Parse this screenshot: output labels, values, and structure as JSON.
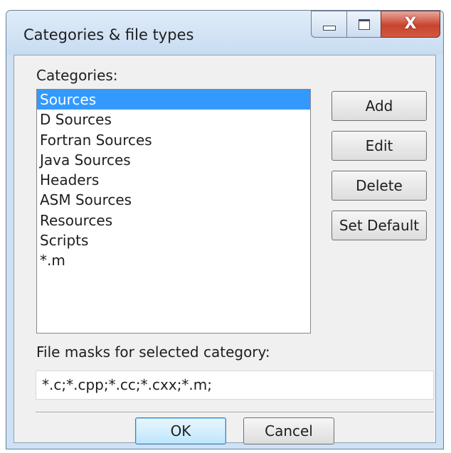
{
  "window": {
    "title": "Categories & file types",
    "caption_buttons": {
      "minimize_icon": "minimize-icon",
      "maximize_icon": "maximize-icon",
      "close_icon": "close-icon",
      "close_glyph": "X"
    }
  },
  "categories": {
    "label": "Categories:",
    "items": [
      {
        "label": "Sources",
        "selected": true
      },
      {
        "label": "D Sources",
        "selected": false
      },
      {
        "label": "Fortran Sources",
        "selected": false
      },
      {
        "label": "Java Sources",
        "selected": false
      },
      {
        "label": "Headers",
        "selected": false
      },
      {
        "label": "ASM Sources",
        "selected": false
      },
      {
        "label": "Resources",
        "selected": false
      },
      {
        "label": "Scripts",
        "selected": false
      },
      {
        "label": "*.m",
        "selected": false
      }
    ]
  },
  "side_buttons": {
    "add": "Add",
    "edit": "Edit",
    "delete": "Delete",
    "set_default": "Set Default"
  },
  "file_masks": {
    "label": "File masks for selected category:",
    "value": "*.c;*.cpp;*.cc;*.cxx;*.m;"
  },
  "footer": {
    "ok": "OK",
    "cancel": "Cancel"
  },
  "colors": {
    "selection": "#3399ff",
    "title_bar": "#c8dcf1",
    "close_button": "#c8432d"
  }
}
